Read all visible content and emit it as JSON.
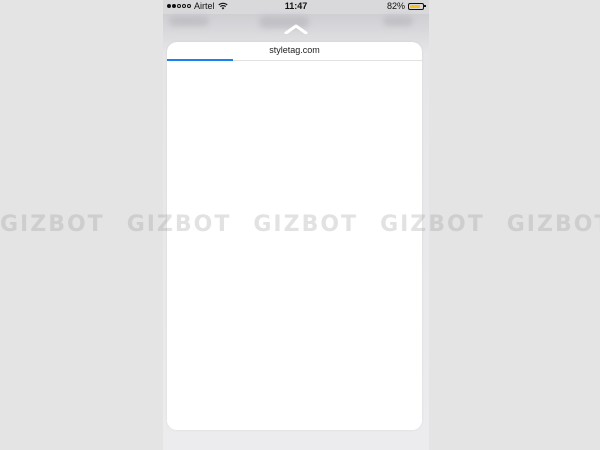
{
  "status_bar": {
    "signal_dots": [
      "full",
      "full",
      "empty",
      "empty",
      "empty"
    ],
    "carrier": "Airtel",
    "time": "11:47",
    "battery_percent_label": "82%",
    "battery_level": 0.82,
    "battery_color": "#f4c026"
  },
  "browser_sheet": {
    "url": "styletag.com",
    "load_progress": 0.26,
    "progress_color": "#1a82f0"
  },
  "watermark": {
    "text": "GIZBOT",
    "repeats": 6
  }
}
